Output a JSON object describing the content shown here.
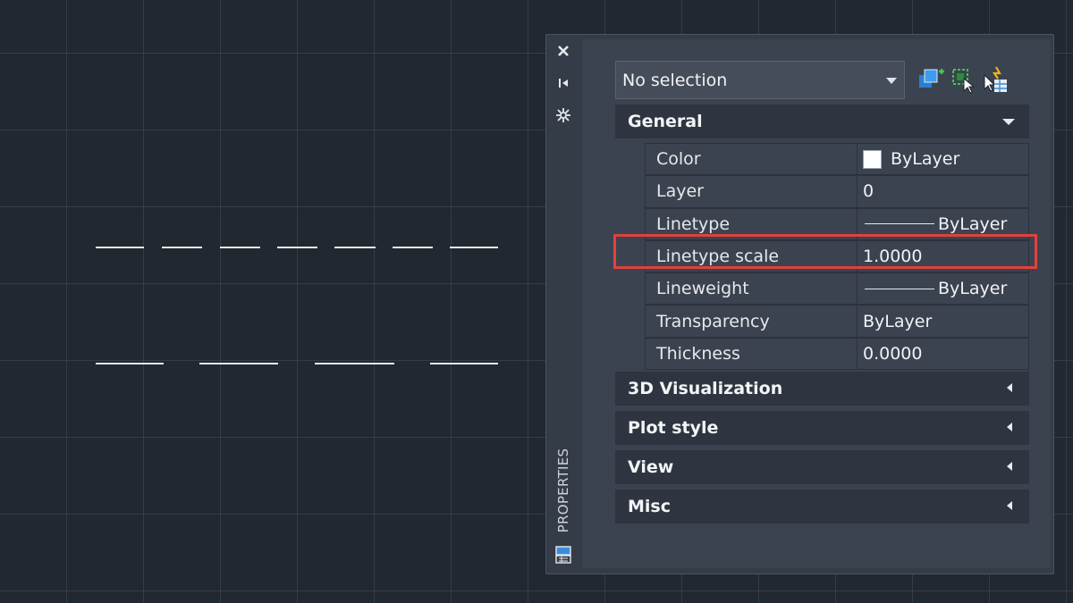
{
  "canvas": {
    "line_color": "#e9ecef",
    "background": "#212830"
  },
  "palette": {
    "title": "PROPERTIES",
    "selection": {
      "value": "No selection"
    },
    "sections": {
      "general": "General",
      "visualization_3d": "3D Visualization",
      "plot_style": "Plot style",
      "view": "View",
      "misc": "Misc"
    },
    "properties": [
      {
        "name": "Color",
        "value": "ByLayer",
        "swatch": "#ffffff"
      },
      {
        "name": "Layer",
        "value": "0"
      },
      {
        "name": "Linetype",
        "value": "ByLayer"
      },
      {
        "name": "Linetype scale",
        "value": "1.0000",
        "highlighted": true
      },
      {
        "name": "Lineweight",
        "value": "ByLayer"
      },
      {
        "name": "Transparency",
        "value": "ByLayer"
      },
      {
        "name": "Thickness",
        "value": "0.0000"
      }
    ],
    "highlight_color": "#e2413b"
  }
}
